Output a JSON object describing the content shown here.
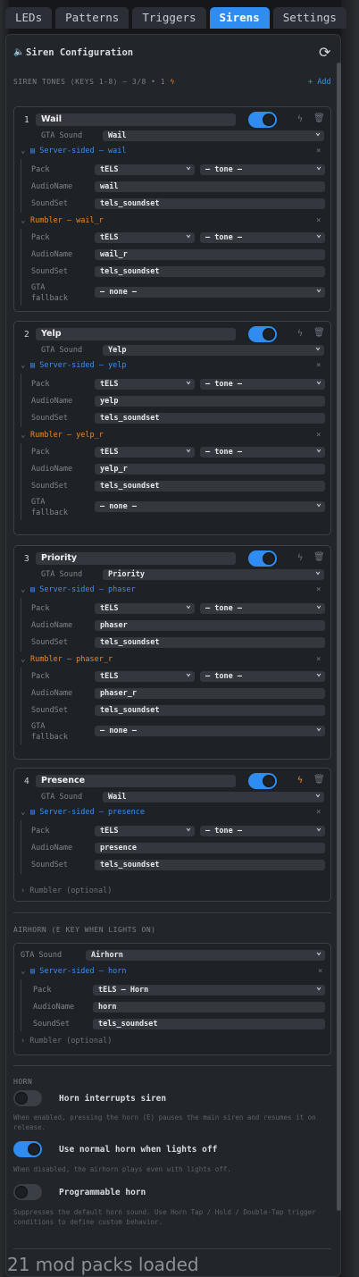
{
  "tabs": [
    {
      "label": "LEDs",
      "active": false
    },
    {
      "label": "Patterns",
      "active": false
    },
    {
      "label": "Triggers",
      "active": false
    },
    {
      "label": "Sirens",
      "active": true
    },
    {
      "label": "Settings",
      "active": false
    }
  ],
  "header": {
    "title": "Siren Configuration"
  },
  "tones": {
    "label": "SIREN TONES (KEYS 1-8) — 3/8 • 1",
    "add_label": "+ Add"
  },
  "field_labels": {
    "gta_sound": "GTA Sound",
    "pack": "Pack",
    "audio_name": "AudioName",
    "sound_set": "SoundSet",
    "gta_fallback": "GTA fallback",
    "rumbler_optional": "Rumbler (optional)"
  },
  "sirens": [
    {
      "num": "1",
      "name": "Wail",
      "gta_sound": "Wail",
      "enabled": true,
      "server_label": "Server-sided — wail",
      "pack": "tELS",
      "tone": "— tone —",
      "audio_name": "wail",
      "sound_set": "tels_soundset",
      "rumbler_label": "Rumbler — wail_r",
      "r_pack": "tELS",
      "r_tone": "— tone —",
      "r_audio_name": "wail_r",
      "r_sound_set": "tels_soundset",
      "r_fallback": "— none —"
    },
    {
      "num": "2",
      "name": "Yelp",
      "gta_sound": "Yelp",
      "enabled": true,
      "server_label": "Server-sided — yelp",
      "pack": "tELS",
      "tone": "— tone —",
      "audio_name": "yelp",
      "sound_set": "tels_soundset",
      "rumbler_label": "Rumbler — yelp_r",
      "r_pack": "tELS",
      "r_tone": "— tone —",
      "r_audio_name": "yelp_r",
      "r_sound_set": "tels_soundset",
      "r_fallback": "— none —"
    },
    {
      "num": "3",
      "name": "Priority",
      "gta_sound": "Priority",
      "enabled": true,
      "server_label": "Server-sided — phaser",
      "pack": "tELS",
      "tone": "— tone —",
      "audio_name": "phaser",
      "sound_set": "tels_soundset",
      "rumbler_label": "Rumbler — phaser_r",
      "r_pack": "tELS",
      "r_tone": "— tone —",
      "r_audio_name": "phaser_r",
      "r_sound_set": "tels_soundset",
      "r_fallback": "— none —"
    },
    {
      "num": "4",
      "name": "Presence",
      "gta_sound": "Wail",
      "enabled": true,
      "server_label": "Server-sided — presence",
      "pack": "tELS",
      "tone": "— tone —",
      "audio_name": "presence",
      "sound_set": "tels_soundset"
    }
  ],
  "airhorn": {
    "label": "AIRHORN (E KEY WHEN LIGHTS ON)",
    "gta_sound": "Airhorn",
    "server_label": "Server-sided — horn",
    "pack": "tELS — Horn",
    "audio_name": "horn",
    "sound_set": "tels_soundset"
  },
  "horn": {
    "label": "HORN",
    "options": [
      {
        "label": "Horn interrupts siren",
        "on": false,
        "desc": "When enabled, pressing the horn (E) pauses the main siren and resumes it on release."
      },
      {
        "label": "Use normal horn when lights off",
        "on": true,
        "desc": "When disabled, the airhorn plays even with lights off."
      },
      {
        "label": "Programmable horn",
        "on": false,
        "desc": "Suppresses the default horn sound. Use Horn Tap / Hold / Double-Tap trigger conditions to define custom behavior."
      }
    ]
  },
  "footer": {
    "status": "21 mod packs loaded"
  },
  "colors": {
    "accent": "#2f8cf0",
    "rumbler": "#e8892b",
    "panel": "#22252a"
  }
}
